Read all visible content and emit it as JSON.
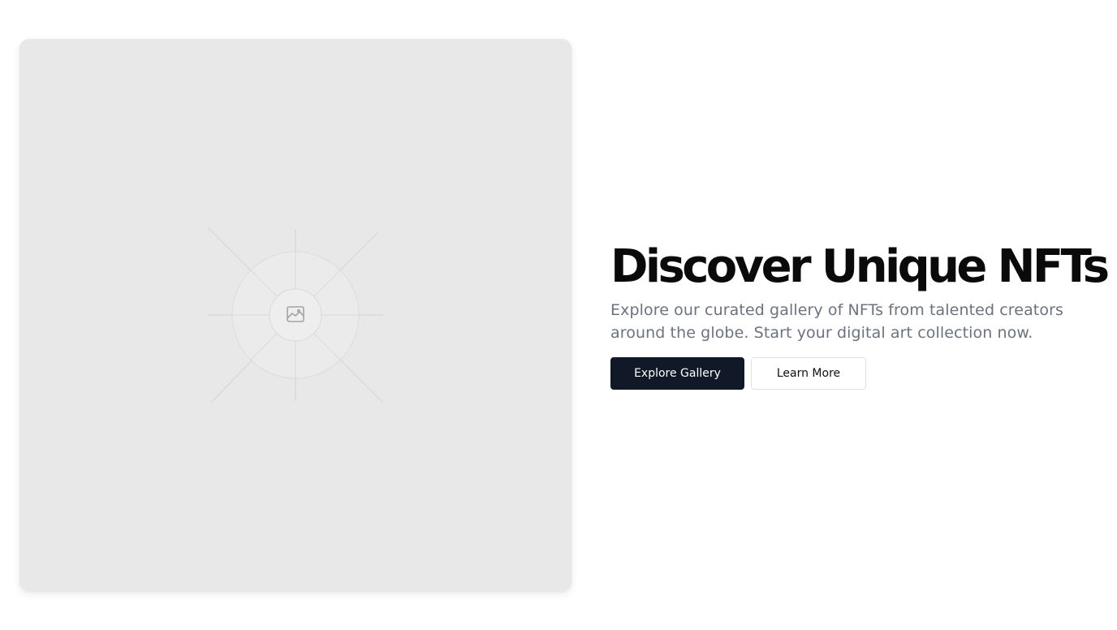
{
  "hero": {
    "media": {
      "icon": "image-icon",
      "colors": {
        "card_background": "#e8e8e8",
        "circle_fill": "#ededed",
        "ray_stroke": "#d4d4d4",
        "icon_stroke": "#a3a3a3"
      }
    },
    "headline": "Discover Unique NFTs",
    "subtitle": "Explore our curated gallery of NFTs from talented creators around the globe. Start your digital art collection now.",
    "buttons": {
      "primary_label": "Explore Gallery",
      "secondary_label": "Learn More"
    },
    "colors": {
      "headline": "#0a0a0a",
      "subtitle": "#6b7280",
      "primary_button_bg": "#111827",
      "primary_button_text": "#ffffff",
      "secondary_button_border": "#e2e2e2"
    }
  }
}
